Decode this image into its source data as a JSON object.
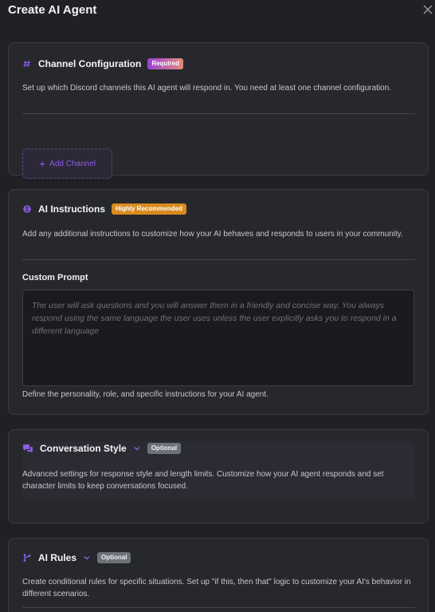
{
  "header": {
    "title": "Create AI Agent",
    "close_icon": "close-icon"
  },
  "colors": {
    "accent": "#8a5ce6",
    "required_from": "#9b3fd6",
    "required_to": "#e58a7a",
    "recommended": "#d98a1e",
    "optional": "#6e7178"
  },
  "channel": {
    "title": "Channel Configuration",
    "badge": "Required",
    "icon": "hash-icon",
    "description": "Set up which Discord channels this AI agent will respond in. You need at least one channel configuration.",
    "add_label": "Add Channel"
  },
  "instructions": {
    "title": "AI Instructions",
    "badge": "Highly Recommended",
    "icon": "brain-icon",
    "description": "Add any additional instructions to customize how your AI behaves and responds to users in your community.",
    "prompt_label": "Custom Prompt",
    "prompt_placeholder": "The user will ask questions and you will answer them in a friendly and concise way. You always respond using the same language the user uses unless the user explicitly asks you to respond in a different language",
    "help": "Define the personality, role, and specific instructions for your AI agent."
  },
  "style": {
    "title": "Conversation Style",
    "badge": "Optional",
    "icon": "chat-bubbles-icon",
    "description": "Advanced settings for response style and length limits. Customize how your AI agent responds and set character limits to keep conversations focused."
  },
  "rules": {
    "title": "AI Rules",
    "badge": "Optional",
    "icon": "branch-icon",
    "description": "Create conditional rules for specific situations. Set up \"if this, then that\" logic to customize your AI's behavior in different scenarios."
  }
}
